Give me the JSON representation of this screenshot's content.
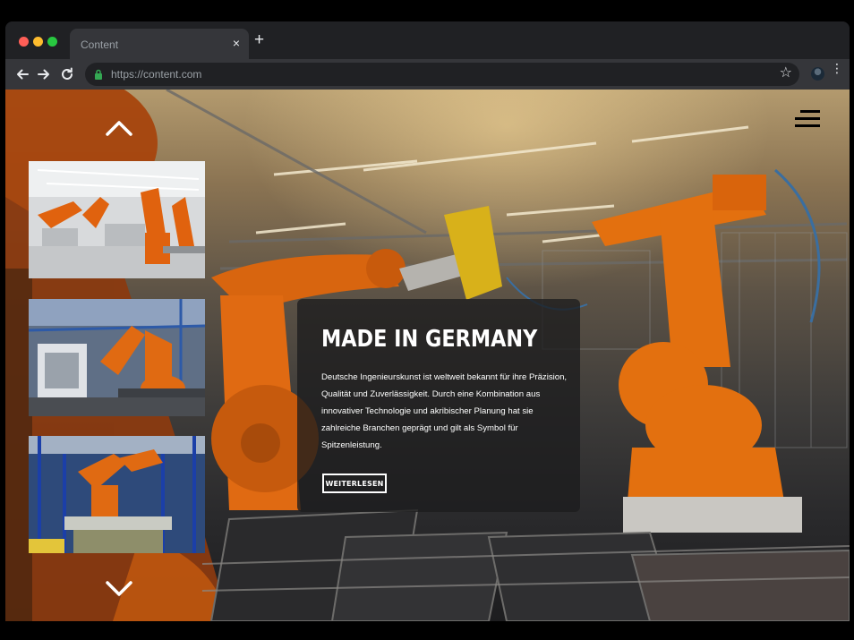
{
  "browser": {
    "tab_title": "Content",
    "tab_close": "×",
    "new_tab": "+",
    "url": "https://content.com",
    "bookmark_icon": "☆",
    "menu_icon": "⋮"
  },
  "hero": {
    "title": "MADE IN GERMANY",
    "body": "Deutsche Ingenieurskunst ist weltweit bekannt für ihre Präzision, Qualität und Zuverlässigkeit. Durch eine Kombination aus innovativer Technologie und akribischer Planung hat sie zahlreiche Branchen geprägt und gilt als Symbol für Spitzenleistung.",
    "button_label": "WEITERLESEN"
  },
  "colors": {
    "robot_orange": "#e06a12",
    "card_bg": "#1c1c1e",
    "chrome_dark": "#202124",
    "chrome_toolbar": "#35363a",
    "secure_green": "#34a853"
  },
  "icons": {
    "menu": "hamburger-icon",
    "up": "chevron-up-icon",
    "down": "chevron-down-icon"
  }
}
